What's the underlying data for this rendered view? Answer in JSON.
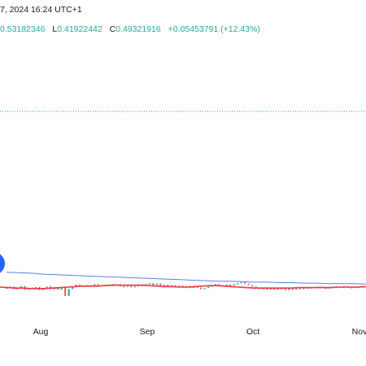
{
  "header": {
    "date_text": "7, 2024 16:24 UTC+1"
  },
  "ohlc": {
    "o_value": "0.53182346",
    "l_label": "L",
    "l_value": "0.41922442",
    "c_label": "C",
    "c_value": "0.49321916",
    "change_text": "+0.05453791 (+12.43%)"
  },
  "colors": {
    "up": "#26a69a",
    "down": "#ef5350",
    "ma_red": "#f23645",
    "ma_blue": "#5b7fe8",
    "dotted_line": "#22ab94",
    "marker": "#2962ff"
  },
  "chart_data": {
    "type": "line",
    "x_tick_labels": [
      "Aug",
      "Sep",
      "Oct",
      "Nov"
    ],
    "y_range_visible": [
      0,
      1
    ],
    "series": [
      {
        "name": "",
        "role": "price",
        "values": [
          0.492,
          0.494,
          0.489,
          0.491,
          0.495,
          0.488,
          0.492,
          0.49,
          0.493,
          0.487,
          0.491,
          0.494,
          0.489,
          0.491,
          0.488,
          0.492,
          0.475,
          0.489,
          0.493,
          0.498,
          0.496,
          0.494,
          0.497,
          0.495,
          0.499,
          0.497,
          0.496,
          0.498,
          0.495,
          0.499,
          0.497,
          0.495,
          0.494,
          0.496,
          0.493,
          0.495,
          0.497,
          0.495,
          0.499,
          0.501,
          0.497,
          0.5,
          0.496,
          0.498,
          0.495,
          0.497,
          0.494,
          0.496,
          0.493,
          0.495,
          0.491,
          0.494,
          0.492,
          0.489,
          0.491,
          0.494,
          0.496,
          0.499,
          0.497,
          0.495,
          0.498,
          0.496,
          0.499,
          0.501,
          0.503,
          0.5,
          0.497,
          0.494,
          0.492,
          0.489,
          0.491,
          0.488,
          0.49,
          0.488,
          0.491,
          0.489,
          0.487,
          0.49,
          0.488,
          0.491,
          0.489,
          0.492,
          0.49,
          0.493,
          0.491,
          0.494,
          0.492,
          0.49,
          0.493,
          0.491,
          0.494,
          0.492,
          0.495,
          0.493,
          0.491,
          0.494,
          0.492,
          0.495,
          0.493
        ]
      },
      {
        "name": "",
        "role": "ma-red",
        "values": [
          0.493,
          0.492,
          0.491,
          0.491,
          0.49,
          0.49,
          0.49,
          0.491,
          0.492,
          0.493,
          0.494,
          0.495,
          0.495,
          0.495,
          0.496,
          0.497,
          0.497,
          0.497,
          0.497,
          0.497,
          0.496,
          0.495,
          0.494,
          0.494,
          0.493,
          0.493,
          0.494,
          0.495,
          0.496,
          0.496,
          0.495,
          0.494,
          0.493,
          0.492,
          0.491,
          0.491,
          0.491,
          0.491,
          0.491,
          0.491,
          0.492,
          0.492,
          0.492,
          0.492,
          0.492,
          0.493,
          0.493,
          0.493,
          0.493,
          0.494
        ]
      },
      {
        "name": "",
        "role": "ma-blue",
        "values": [
          0.523,
          0.522,
          0.521,
          0.519,
          0.518,
          0.517,
          0.516,
          0.515,
          0.514,
          0.513,
          0.512,
          0.511,
          0.51,
          0.509,
          0.508,
          0.507,
          0.506,
          0.505,
          0.505,
          0.504,
          0.503,
          0.503,
          0.502,
          0.502,
          0.501,
          0.501,
          0.5,
          0.5,
          0.5,
          0.499
        ]
      }
    ],
    "horizontal_level": 0.847
  }
}
